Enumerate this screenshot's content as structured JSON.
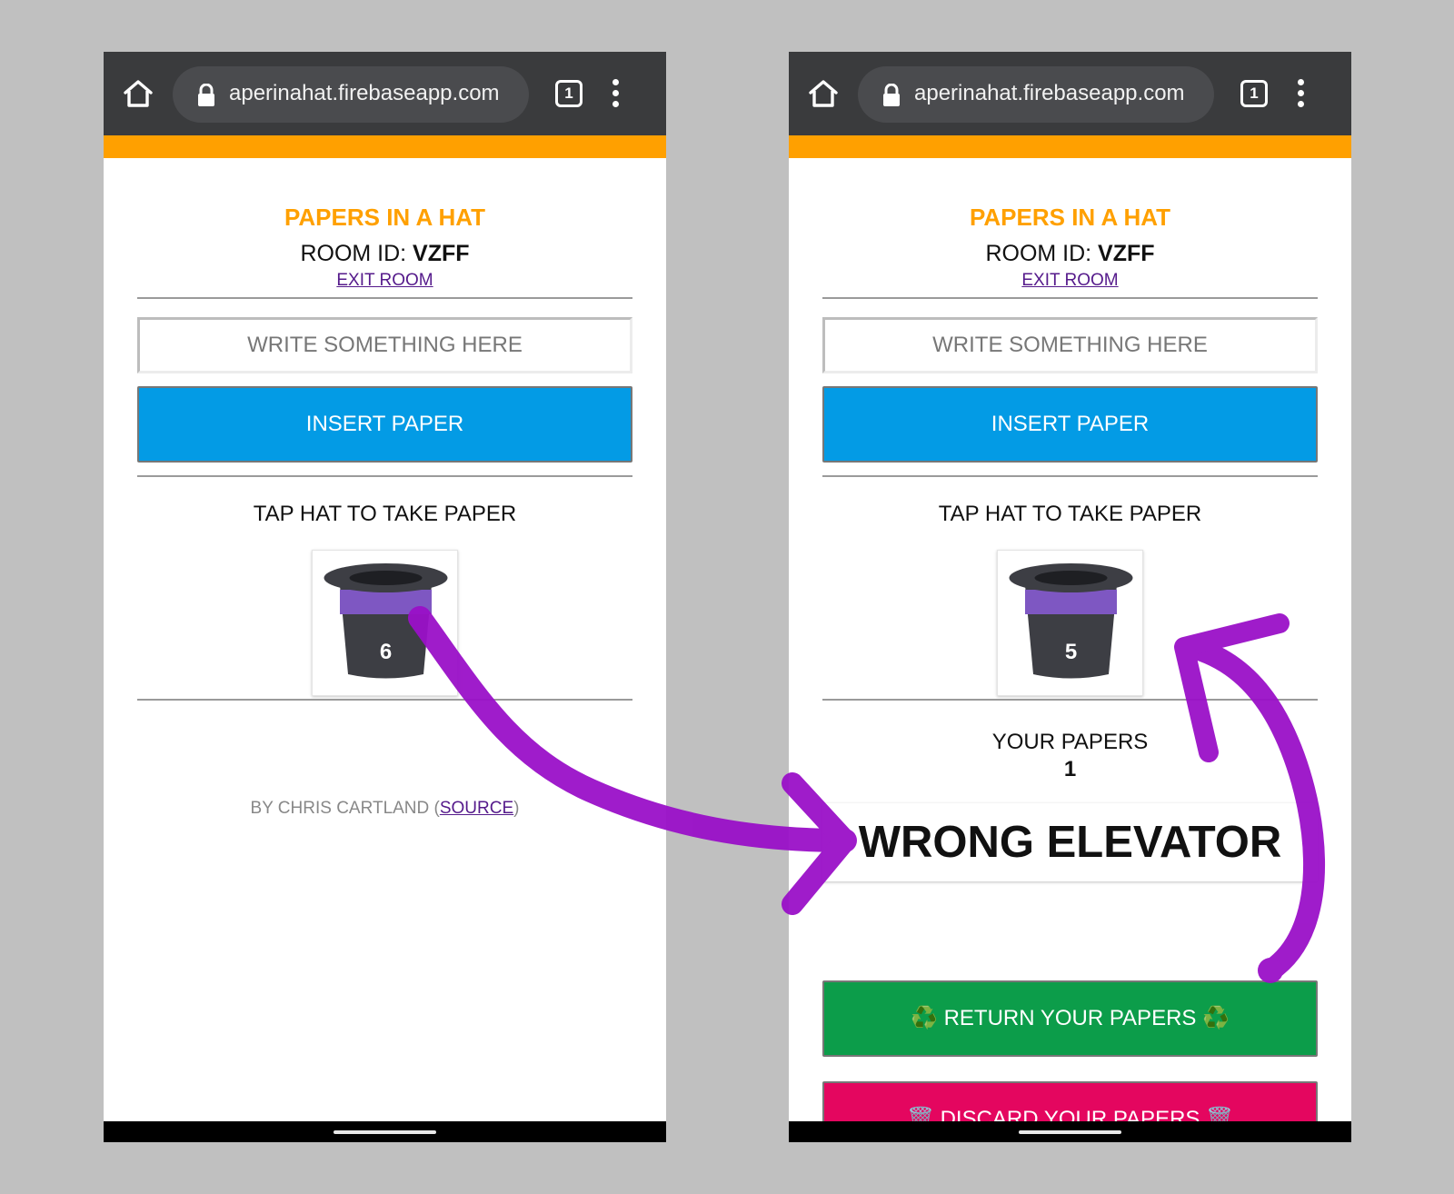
{
  "browser": {
    "url": "aperinahat.firebaseapp.com",
    "tab_count": "1"
  },
  "app": {
    "title": "PAPERS IN A HAT",
    "room_label": "ROOM ID: ",
    "room_id": "VZFF",
    "exit_room": "EXIT ROOM",
    "input_placeholder": "WRITE SOMETHING HERE",
    "insert_button": "INSERT PAPER",
    "tap_hat_label": "TAP HAT TO TAKE PAPER"
  },
  "left_screen": {
    "hat_count": "6",
    "credit_prefix": "BY CHRIS CARTLAND (",
    "credit_link": "SOURCE",
    "credit_suffix": ")"
  },
  "right_screen": {
    "hat_count": "5",
    "your_papers_label": "YOUR PAPERS",
    "your_papers_count": "1",
    "drawn_paper": "WRONG ELEVATOR",
    "return_button": "♻️ RETURN YOUR PAPERS ♻️",
    "discard_button": "🗑️ DISCARD YOUR PAPERS 🗑️"
  },
  "colors": {
    "background": "#c0c0c0",
    "chrome_bar": "#3a3b3d",
    "accent_orange": "#ffa000",
    "insert_blue": "#039be5",
    "return_green": "#0c9d4a",
    "discard_pink": "#e4065f",
    "annotation_purple": "#9a10c8"
  },
  "icons": {
    "browser": [
      "home-icon",
      "lock-icon",
      "tabs-icon",
      "more-vert-icon"
    ],
    "hat": "magic-hat-icon",
    "annotation": "purple-arrow"
  }
}
